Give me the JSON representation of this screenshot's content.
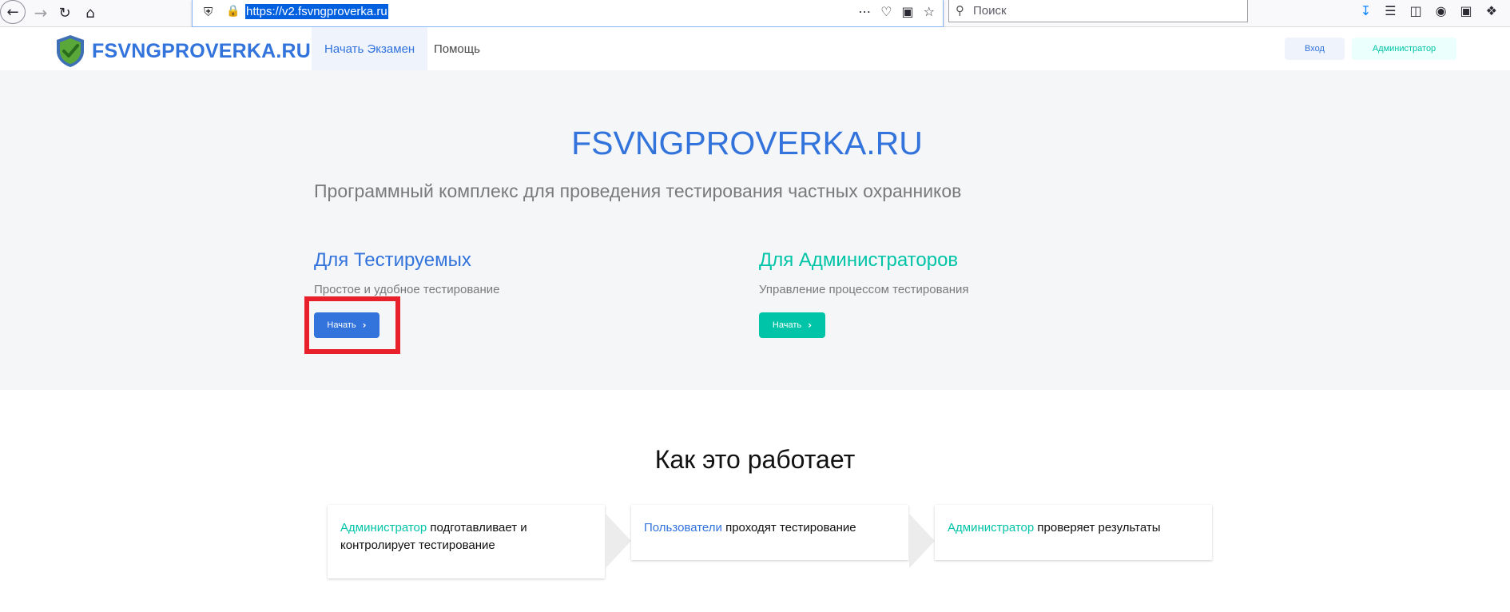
{
  "browser": {
    "url": "https://v2.fsvngproverka.ru",
    "search_placeholder": "Поиск"
  },
  "navbar": {
    "brand": "FSVNGPROVERKA.RU",
    "items": [
      {
        "label": "Начать Экзамен",
        "active": true
      },
      {
        "label": "Помощь",
        "active": false
      }
    ],
    "login_label": "Вход",
    "admin_label": "Администратор"
  },
  "hero": {
    "title": "FSVNGPROVERKA.RU",
    "subtitle": "Программный комплекс для проведения тестирования частных охранников",
    "users": {
      "title": "Для Тестируемых",
      "description": "Простое и удобное тестирование",
      "button": "Начать"
    },
    "admins": {
      "title": "Для Администраторов",
      "description": "Управление процессом тестирования",
      "button": "Начать"
    }
  },
  "how": {
    "title": "Как это работает",
    "steps": [
      {
        "accent": "Администратор",
        "text": " подготавливает и контролирует тестирование"
      },
      {
        "accent": "Пользователи",
        "text": " проходят тестирование"
      },
      {
        "accent": "Администратор",
        "text": " проверяет результаты"
      }
    ]
  },
  "colors": {
    "primary": "#3273dc",
    "success": "#00c4a7",
    "highlight": "#e8202a"
  }
}
